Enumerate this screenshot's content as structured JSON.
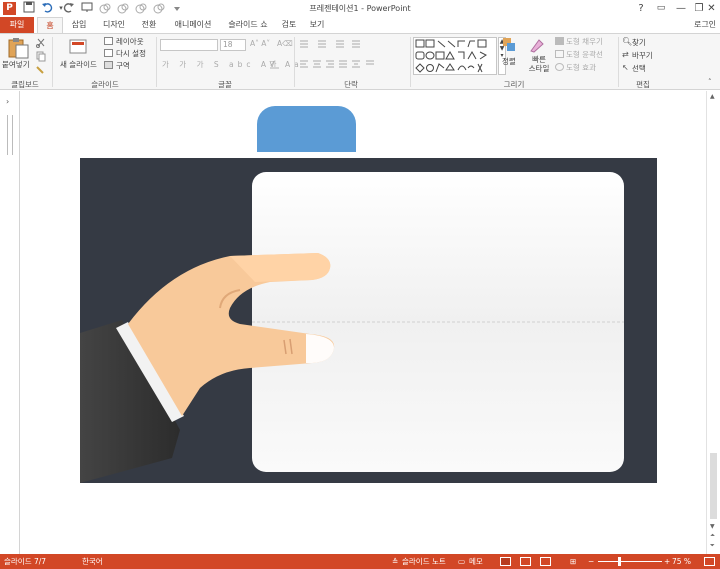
{
  "window": {
    "title": "프레젠테이션1 - PowerPoint",
    "app_letter": "P",
    "login": "로그인",
    "minimize": "—",
    "restore": "❐",
    "close": "✕",
    "help": "?"
  },
  "qat": {
    "save_icon": "save-icon",
    "undo_icon": "undo-icon",
    "redo_icon": "redo-icon"
  },
  "tabs": [
    "파일",
    "홈",
    "삽입",
    "디자인",
    "전환",
    "애니메이션",
    "슬라이드 쇼",
    "검토",
    "보기"
  ],
  "ribbon": {
    "clipboard": {
      "paste": "붙여넣기",
      "label": "클립보드"
    },
    "slides": {
      "new_slide": "새 슬라이드",
      "layout": "레이아웃",
      "reset": "다시 설정",
      "section": "구역",
      "label": "슬라이드"
    },
    "font": {
      "size": "18",
      "label": "글꼴"
    },
    "paragraph": {
      "label": "단락"
    },
    "drawing": {
      "arrange": "정렬",
      "quick_styles": "빠른 스타일",
      "fill": "도형 채우기",
      "outline": "도형 윤곽선",
      "effects": "도형 효과",
      "label": "그리기"
    },
    "editing": {
      "find": "찾기",
      "replace": "바꾸기",
      "select": "선택",
      "label": "편집"
    }
  },
  "status": {
    "slide_counter": "슬라이드 7/7",
    "language": "한국어",
    "notes": "슬라이드 노트",
    "comments": "메모",
    "zoom": "75 %"
  },
  "colors": {
    "accent": "#d24726",
    "slide_bg": "#353a44",
    "tab_shape": "#5b9bd5",
    "card": "#ffffff",
    "skin": "#f8c99a",
    "sleeve": "#3d3d3d"
  }
}
